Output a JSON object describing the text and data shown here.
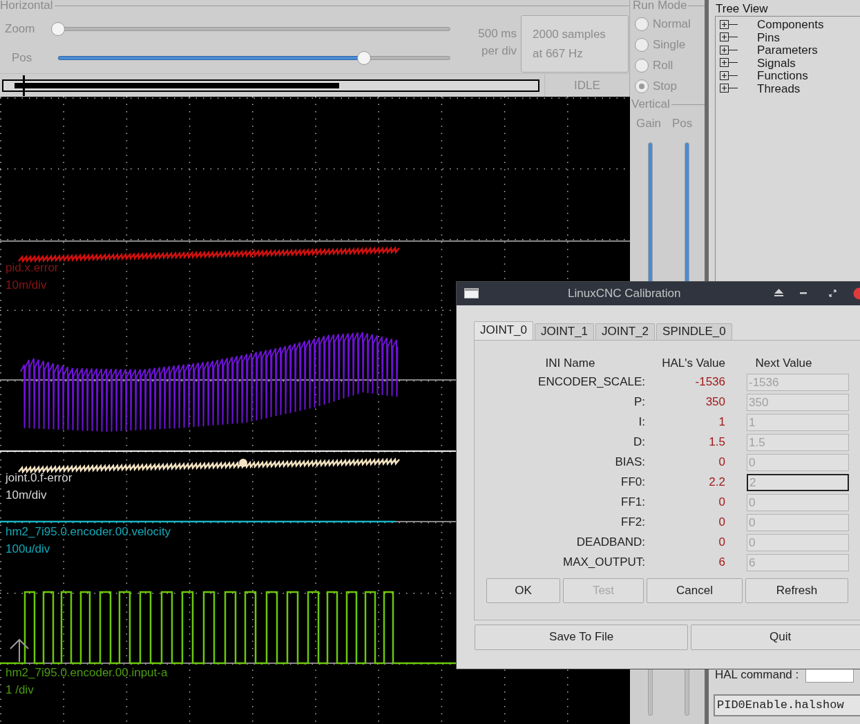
{
  "scope": {
    "horizontal": {
      "title": "Horizontal",
      "zoom": {
        "label": "Zoom",
        "level": 0
      },
      "pos": {
        "label": "Pos",
        "level": 0.78
      },
      "rate": [
        "500 ms",
        "per div"
      ],
      "samples_button": [
        "2000 samples",
        "at 667 Hz"
      ],
      "state": "IDLE"
    },
    "run_mode": {
      "title": "Run Mode",
      "options": [
        {
          "label": "Normal",
          "selected": false
        },
        {
          "label": "Single",
          "selected": false
        },
        {
          "label": "Roll",
          "selected": false
        },
        {
          "label": "Stop",
          "selected": true
        }
      ]
    },
    "vertical": {
      "title": "Vertical",
      "sliders": [
        {
          "label": "Gain",
          "level": 0.84
        },
        {
          "label": "Pos",
          "level": 0.84
        }
      ]
    },
    "channels": [
      {
        "name": "pid.x.error",
        "scale": "10m/div",
        "color": "#8b1515"
      },
      {
        "name": "joint.0.f-error",
        "scale": "10m/div",
        "color": "#d8d8d8"
      },
      {
        "name": "hm2_7i95.0.encoder.00.velocity",
        "scale": "100u/div",
        "color": "#12a9b8"
      },
      {
        "name": "hm2_7i95.0.encoder.00.input-a",
        "scale": "1 /div",
        "color": "#4c9c12"
      }
    ]
  },
  "halshow": {
    "tree_title": "Tree View",
    "tree": [
      {
        "label": "Components",
        "expanded": false
      },
      {
        "label": "Pins",
        "expanded": false
      },
      {
        "label": "Parameters",
        "expanded": false
      },
      {
        "label": "Signals",
        "expanded": false
      },
      {
        "label": "Functions",
        "expanded": false
      },
      {
        "label": "Threads",
        "expanded": false
      }
    ],
    "hal_command_label": "HAL command :",
    "file_field": "PID0Enable.halshow"
  },
  "dialog": {
    "title": "LinuxCNC Calibration",
    "tabs": [
      {
        "label": "JOINT_0",
        "selected": true
      },
      {
        "label": "JOINT_1",
        "selected": false
      },
      {
        "label": "JOINT_2",
        "selected": false
      },
      {
        "label": "SPINDLE_0",
        "selected": false
      }
    ],
    "columns": [
      "INI Name",
      "HAL's Value",
      "Next Value"
    ],
    "rows": [
      {
        "name": "ENCODER_SCALE:",
        "hal_value": "-1536",
        "next_value": "-1536",
        "focused": false
      },
      {
        "name": "P:",
        "hal_value": "350",
        "next_value": "350",
        "focused": false
      },
      {
        "name": "I:",
        "hal_value": "1",
        "next_value": "1",
        "focused": false
      },
      {
        "name": "D:",
        "hal_value": "1.5",
        "next_value": "1.5",
        "focused": false
      },
      {
        "name": "BIAS:",
        "hal_value": "0",
        "next_value": "0",
        "focused": false
      },
      {
        "name": "FF0:",
        "hal_value": "2.2",
        "next_value": "2",
        "focused": true
      },
      {
        "name": "FF1:",
        "hal_value": "0",
        "next_value": "0",
        "focused": false
      },
      {
        "name": "FF2:",
        "hal_value": "0",
        "next_value": "0",
        "focused": false
      },
      {
        "name": "DEADBAND:",
        "hal_value": "0",
        "next_value": "0",
        "focused": false
      },
      {
        "name": "MAX_OUTPUT:",
        "hal_value": "6",
        "next_value": "6",
        "focused": false
      }
    ],
    "buttons": [
      {
        "label": "OK",
        "disabled": false
      },
      {
        "label": "Test",
        "disabled": true
      },
      {
        "label": "Cancel",
        "disabled": false
      },
      {
        "label": "Refresh",
        "disabled": false
      }
    ],
    "footer_buttons": [
      "Save To File",
      "Quit"
    ]
  }
}
